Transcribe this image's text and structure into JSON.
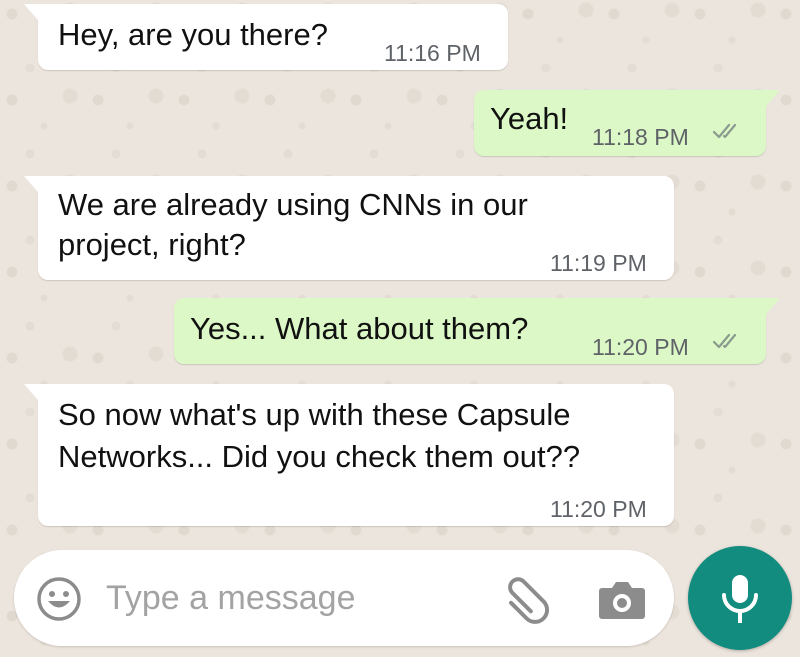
{
  "messages": [
    {
      "direction": "incoming",
      "lines": [
        "Hey, are you there?"
      ],
      "time": "11:16 PM"
    },
    {
      "direction": "outgoing",
      "lines": [
        "Yeah!"
      ],
      "time": "11:18 PM",
      "read_receipt": "double-check-icon"
    },
    {
      "direction": "incoming",
      "lines": [
        "We are already using CNNs in our",
        "project, right?"
      ],
      "time": "11:19 PM"
    },
    {
      "direction": "outgoing",
      "lines": [
        "Yes... What about them?"
      ],
      "time": "11:20 PM",
      "read_receipt": "double-check-icon"
    },
    {
      "direction": "incoming",
      "lines": [
        "So now what's up with these Capsule",
        "Networks... Did you check them out??"
      ],
      "time": "11:20 PM"
    }
  ],
  "composer": {
    "placeholder": "Type a message",
    "value": "",
    "emoji_icon": "smiley-icon",
    "attach_icon": "paperclip-icon",
    "camera_icon": "camera-icon",
    "mic_icon": "microphone-icon"
  },
  "colors": {
    "background": "#ece5dd",
    "incoming_bubble": "#ffffff",
    "outgoing_bubble": "#dcf8c6",
    "timestamp": "#5f6368",
    "read_ticks": "#8a9a8e",
    "mic_button": "#128c7e",
    "icon_grey": "#8c8c8c"
  }
}
